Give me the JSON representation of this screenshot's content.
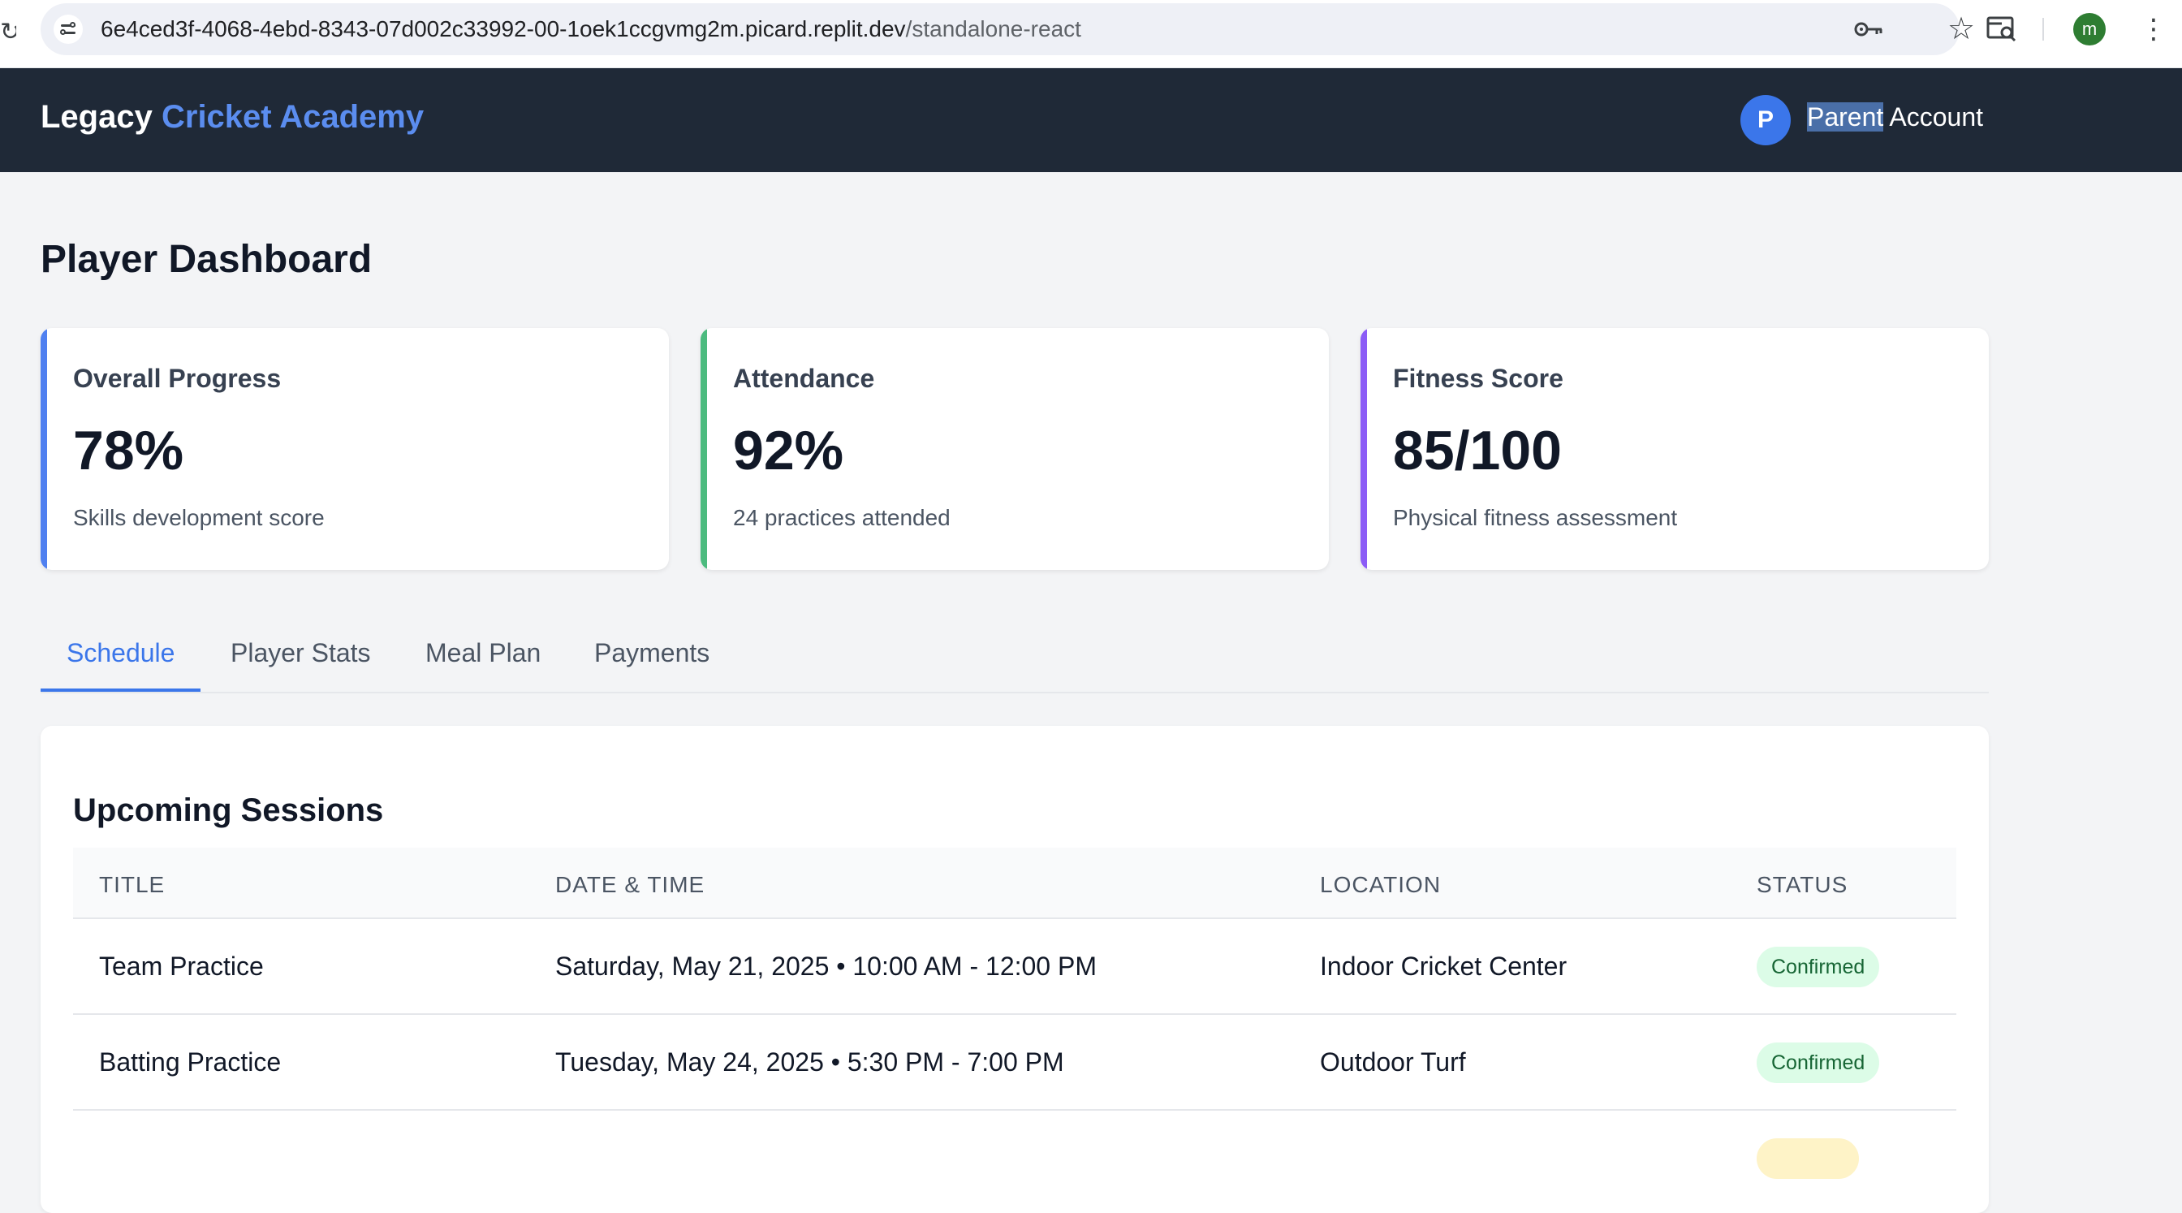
{
  "browser": {
    "url_host": "6e4ced3f-4068-4ebd-8343-07d002c33992-00-1oek1ccgvmg2m.picard.replit.dev",
    "url_path": "/standalone-react",
    "profile_initial": "m"
  },
  "header": {
    "brand_first": "Legacy",
    "brand_accent": "Cricket Academy",
    "user_initial": "P",
    "user_label_selected": "Parent",
    "user_label_rest": " Account"
  },
  "page": {
    "title": "Player Dashboard"
  },
  "cards": [
    {
      "label": "Overall Progress",
      "value": "78%",
      "sub": "Skills development score",
      "color": "#4f80f0"
    },
    {
      "label": "Attendance",
      "value": "92%",
      "sub": "24 practices attended",
      "color": "#4cbb7f"
    },
    {
      "label": "Fitness Score",
      "value": "85/100",
      "sub": "Physical fitness assessment",
      "color": "#8b5cf6"
    }
  ],
  "tabs": [
    {
      "label": "Schedule",
      "active": true
    },
    {
      "label": "Player Stats",
      "active": false
    },
    {
      "label": "Meal Plan",
      "active": false
    },
    {
      "label": "Payments",
      "active": false
    }
  ],
  "sessions": {
    "title": "Upcoming Sessions",
    "columns": [
      "TITLE",
      "DATE & TIME",
      "LOCATION",
      "STATUS"
    ],
    "rows": [
      {
        "title": "Team Practice",
        "datetime": "Saturday, May 21, 2025 • 10:00 AM - 12:00 PM",
        "location": "Indoor Cricket Center",
        "status": "Confirmed"
      },
      {
        "title": "Batting Practice",
        "datetime": "Tuesday, May 24, 2025 • 5:30 PM - 7:00 PM",
        "location": "Outdoor Turf",
        "status": "Confirmed"
      }
    ]
  }
}
